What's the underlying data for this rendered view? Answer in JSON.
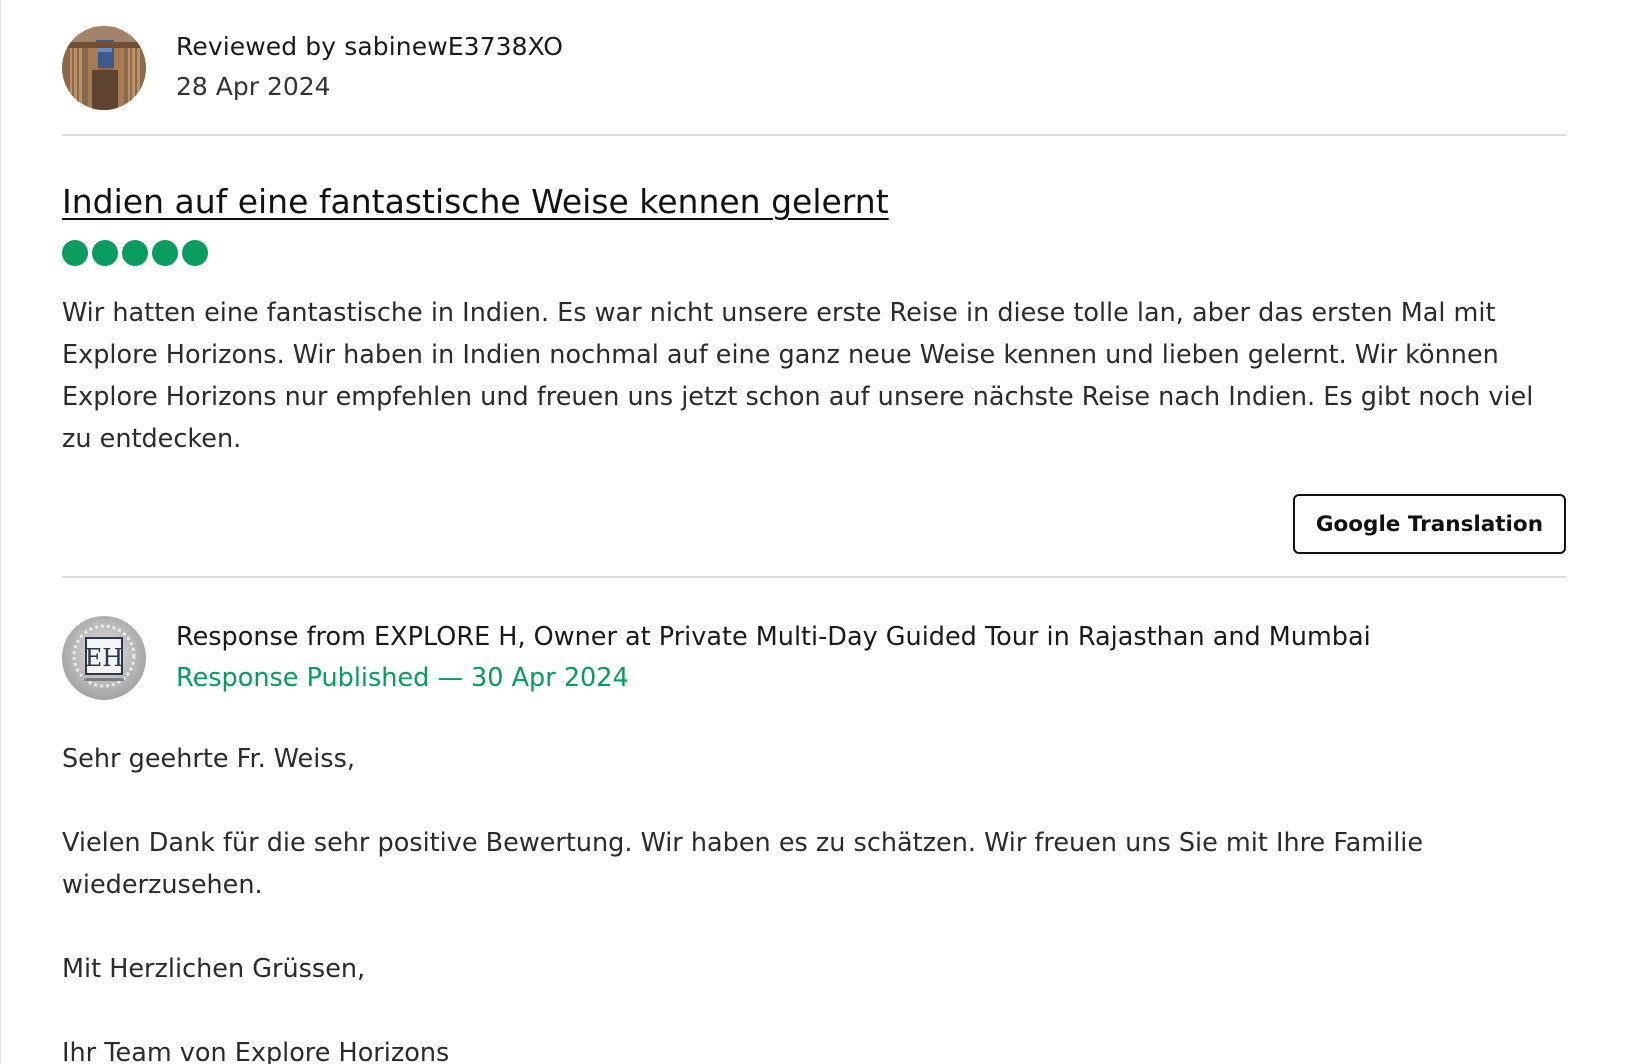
{
  "reviewer": {
    "name": "Reviewed by sabinewE3738XO",
    "date": "28 Apr 2024"
  },
  "review": {
    "title": "Indien auf eine fantastische Weise kennen gelernt",
    "rating": 5,
    "rating_max": 5,
    "rating_color": "#0a9b5f",
    "body": "Wir hatten eine fantastische in Indien. Es war nicht unsere erste Reise in diese tolle lan, aber das ersten Mal mit Explore Horizons. Wir haben in Indien nochmal auf eine ganz neue Weise kennen und lieben gelernt. Wir können Explore Horizons nur empfehlen und freuen uns jetzt schon auf unsere nächste Reise nach Indien. Es gibt noch viel zu entdecken.",
    "translate_label": "Google Translation"
  },
  "response": {
    "from": "Response from EXPLORE H, Owner at Private Multi-Day Guided Tour in Rajasthan and Mumbai",
    "published": "Response Published — 30 Apr 2024",
    "paragraphs": [
      "Sehr geehrte Fr. Weiss,",
      "Vielen Dank für die sehr positive Bewertung. Wir haben es zu schätzen. Wir freuen uns Sie mit Ihre Familie wiederzusehen.",
      "Mit Herzlichen Grüssen,",
      "Ihr Team von Explore Horizons"
    ],
    "logo_letters": "EH"
  },
  "colors": {
    "accent_green": "#0a9b5f",
    "divider": "#dcdcdc"
  }
}
